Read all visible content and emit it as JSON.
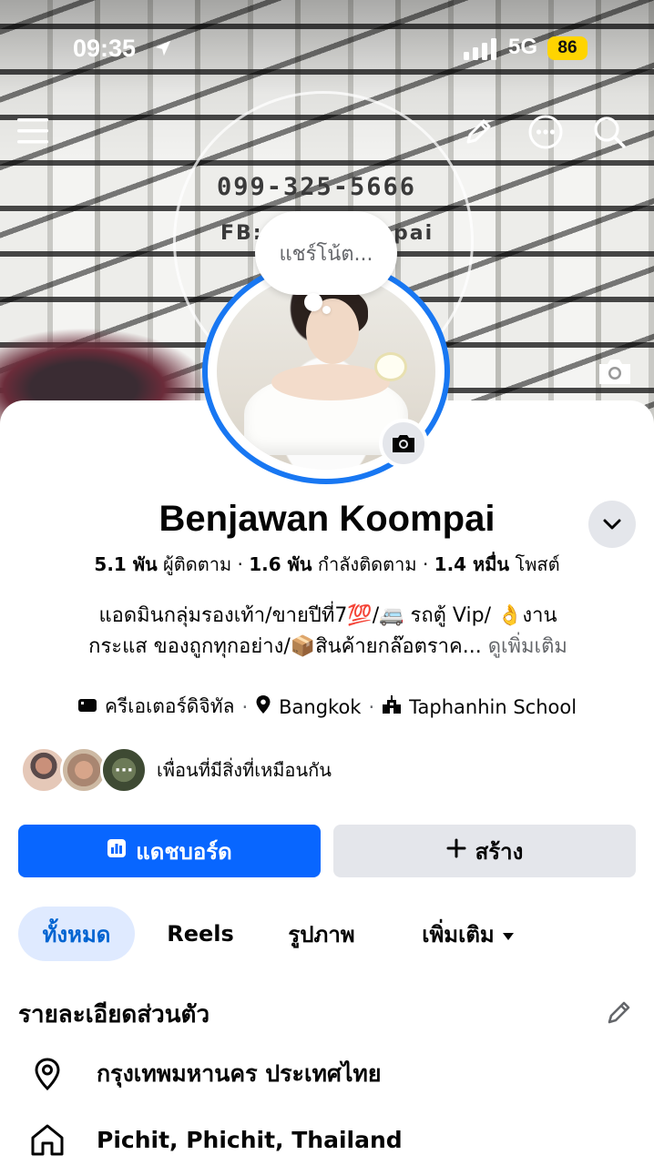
{
  "status_bar": {
    "time": "09:35",
    "network": "5G",
    "battery": "86"
  },
  "cover": {
    "phone": "099-325-5666",
    "fb_left": "FB:",
    "fb_right": "pai"
  },
  "note": {
    "placeholder": "แชร์โน้ต..."
  },
  "profile": {
    "name": "Benjawan Koompai",
    "followers_num": "5.1 พัน",
    "followers_label": "ผู้ติดตาม",
    "following_num": "1.6 พัน",
    "following_label": "กำลังติดตาม",
    "posts_num": "1.4 หมื่น",
    "posts_label": "โพสต์",
    "separator": "·",
    "bio_line1": "แอดมินกลุ่มรองเท้า/ขายปีที่7💯/🚐 รถตู้ Vip/ 👌งาน",
    "bio_line2": "กระแส ของถูกทุกอย่าง/📦สินค้ายกล๊อตราค...",
    "see_more": "ดูเพิ่มเติม",
    "meta": {
      "category": "ครีเอเตอร์ดิจิทัล",
      "city": "Bangkok",
      "school": "Taphanhin School"
    },
    "mutual_text": "เพื่อนที่มีสิ่งที่เหมือนกัน",
    "mutual_more": "···"
  },
  "buttons": {
    "dashboard": "แดชบอร์ด",
    "create": "สร้าง"
  },
  "tabs": {
    "all": "ทั้งหมด",
    "reels": "Reels",
    "photos": "รูปภาพ",
    "more": "เพิ่มเติม"
  },
  "details": {
    "title": "รายละเอียดส่วนตัว",
    "location": "กรุงเทพมหานคร ประเทศไทย",
    "hometown": "Pichit, Phichit, Thailand"
  },
  "colors": {
    "primary": "#0866ff",
    "tab_active_bg": "#dfeaff",
    "tab_active_text": "#0064d1",
    "secondary_bg": "#e4e6eb",
    "battery": "#ffd400"
  },
  "icons": {
    "menu": "menu-icon",
    "edit": "pencil-icon",
    "more": "more-icon",
    "search": "search-icon",
    "camera": "camera-icon",
    "chevron": "chevron-down-icon",
    "location": "location-pin-icon",
    "home": "home-icon"
  }
}
